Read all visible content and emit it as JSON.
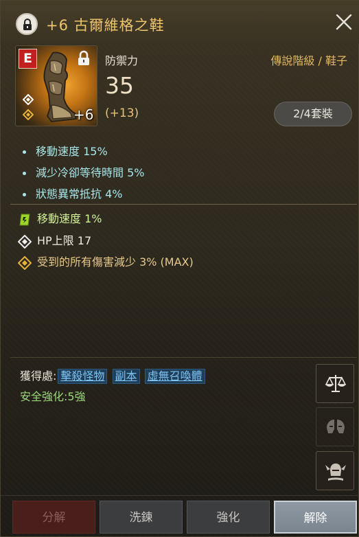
{
  "header": {
    "title": "+6 古爾維格之鞋"
  },
  "item": {
    "grade_letter": "E",
    "enhance_level": "+6",
    "stat_label": "防禦力",
    "stat_value": "35",
    "stat_bonus": "(+13)",
    "grade_type": "傳說階級 / 鞋子",
    "set_badge": "2/4套裝"
  },
  "base_effects": [
    "移動速度  15%",
    "減少冷卻等待時間  5%",
    "狀態異常抵抗  4%"
  ],
  "extra_effects": [
    {
      "icon": "green-scroll-icon",
      "text": "移動速度  1%"
    },
    {
      "icon": "white-diamond-icon",
      "text": "HP上限  17"
    },
    {
      "icon": "gold-diamond-icon",
      "text": "受到的所有傷害減少  3%  (MAX)"
    }
  ],
  "acquire": {
    "label": "獲得處:",
    "links": [
      "擊殺怪物",
      "副本",
      "虛無召喚體"
    ]
  },
  "safe_enhance": "安全強化:5強",
  "side_buttons": [
    "scales-icon",
    "split-helmet-icon",
    "winged-helmet-icon"
  ],
  "actions": {
    "decompose": "分解",
    "refine": "洗鍊",
    "enhance": "強化",
    "release": "解除"
  },
  "colors": {
    "title": "#eec46c",
    "base_effect": "#a8e6ea",
    "extra_green": "#d2f29a",
    "extra_gold": "#e8c98a",
    "link": "#7ec2f0",
    "safe": "#9ad87a",
    "grade_badge": "#c21f1f"
  }
}
